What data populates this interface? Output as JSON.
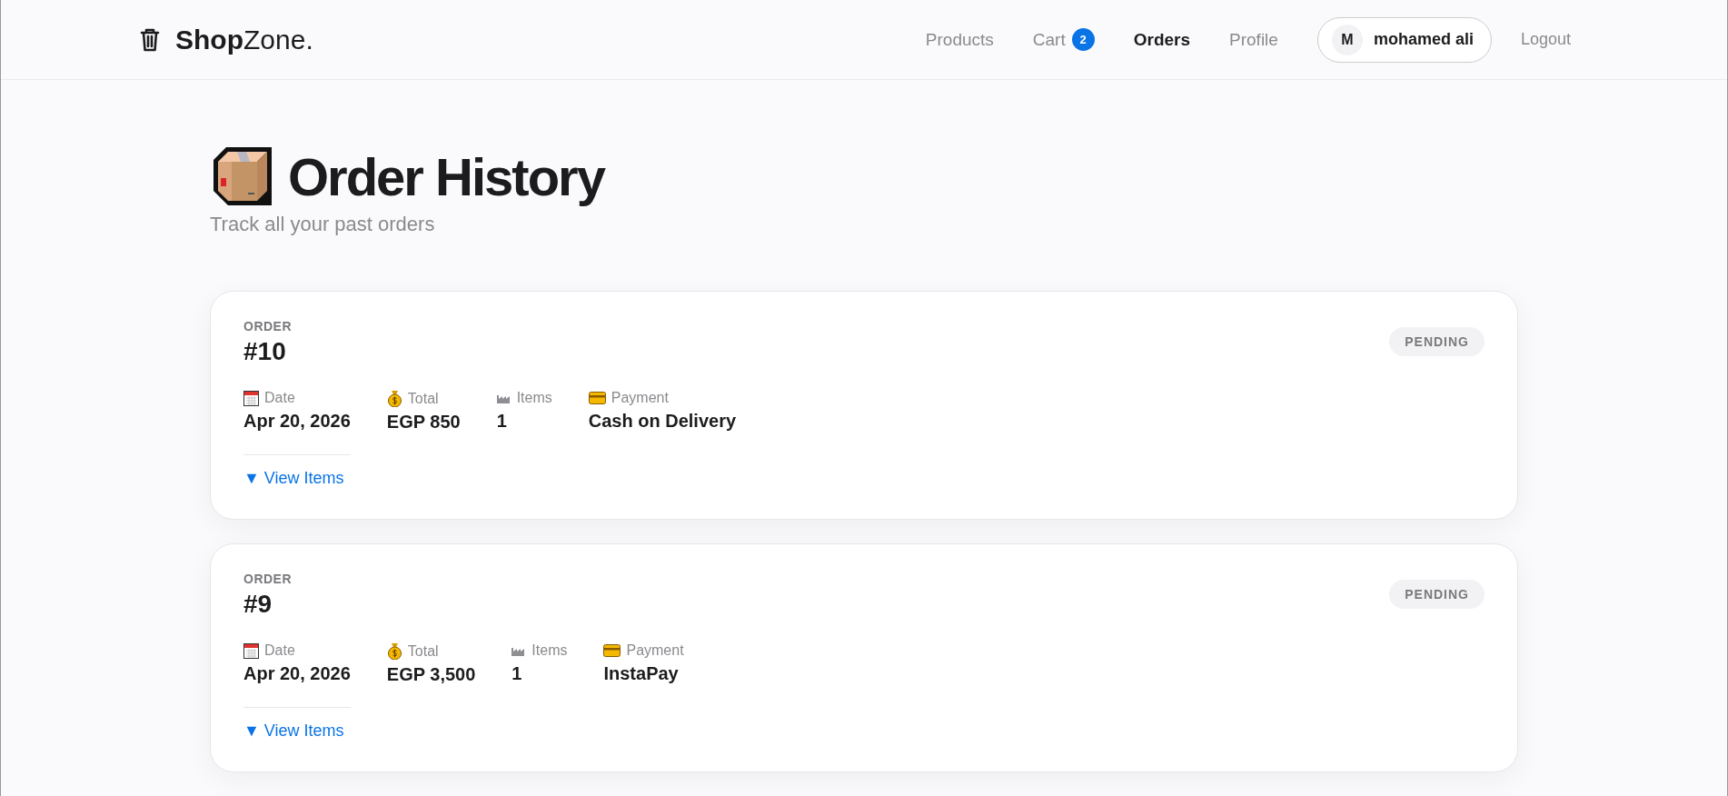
{
  "brand": {
    "text": "**Shop**Zone."
  },
  "nav": [
    {
      "label": "Products",
      "selected": false
    },
    {
      "label": "Cart",
      "selected": false,
      "badge": "2"
    },
    {
      "label": "Orders",
      "selected": true
    },
    {
      "label": "Profile",
      "selected": false
    }
  ],
  "user": {
    "initial": "M",
    "name": "mohamed ali"
  },
  "logout": "Logout",
  "page": {
    "title": "Order History",
    "subtitle": "Track all your past orders"
  },
  "orders": [
    {
      "label": "ORDER",
      "number": "#10",
      "status": "PENDING",
      "fields": [
        {
          "kind": "date",
          "label": "Date",
          "value": "Apr 20, 2026"
        },
        {
          "kind": "total",
          "label": "Total",
          "value": "EGP 850"
        },
        {
          "kind": "items",
          "label": "Items",
          "value": "1"
        },
        {
          "kind": "payment",
          "label": "Payment",
          "value": "Cash on Delivery"
        }
      ],
      "toggle": "▼ View Items"
    },
    {
      "label": "ORDER",
      "number": "#9",
      "status": "PENDING",
      "fields": [
        {
          "kind": "date",
          "label": "Date",
          "value": "Apr 20, 2026"
        },
        {
          "kind": "total",
          "label": "Total",
          "value": "EGP 3,500"
        },
        {
          "kind": "items",
          "label": "Items",
          "value": "1"
        },
        {
          "kind": "payment",
          "label": "Payment",
          "value": "InstaPay"
        }
      ],
      "toggle": "▼ View Items"
    }
  ]
}
